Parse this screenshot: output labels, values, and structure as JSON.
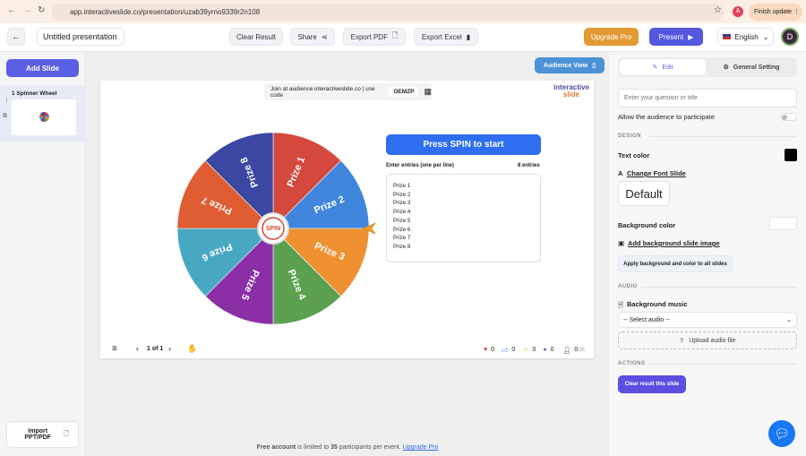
{
  "browser": {
    "url": "app.interactiveslide.co/presentation/uzab39yrno9339r2n108",
    "finish_update": "Finish update",
    "profile_initial": "A"
  },
  "header": {
    "title": "Untitled presentation",
    "clear_result": "Clear Result",
    "share": "Share",
    "export_pdf": "Export PDF",
    "export_excel": "Export Excel",
    "upgrade_pro": "Upgrade Pro",
    "present": "Present",
    "language": "English",
    "avatar": "D"
  },
  "sidebar": {
    "add_slide": "Add Slide",
    "slides": [
      {
        "label": "1 Spinner Wheel"
      }
    ],
    "import": "Import PPT/PDF"
  },
  "slide": {
    "audience_view": "Audience View",
    "join_text": "Join at audience.interactiveslide.co | use code",
    "code": "OEMZP",
    "logo_top": "interactive",
    "logo_bottom": "slide",
    "spin_button": "Press SPIN to start",
    "entries_label": "Enter entries (one per line)",
    "entries_count": "8 entries",
    "spin_center": "SPIN",
    "wheel": [
      {
        "label": "Prize 1",
        "color": "#d4483d"
      },
      {
        "label": "Prize 2",
        "color": "#3f86dc"
      },
      {
        "label": "Prize 3",
        "color": "#ef9130"
      },
      {
        "label": "Prize 4",
        "color": "#5ba14f"
      },
      {
        "label": "Prize 5",
        "color": "#8a2fa6"
      },
      {
        "label": "Prize 6",
        "color": "#48a8c2"
      },
      {
        "label": "Prize 7",
        "color": "#e05c32"
      },
      {
        "label": "Prize 8",
        "color": "#3b47a3"
      }
    ]
  },
  "footer": {
    "page": "1 of 1",
    "hearts": "0",
    "likes": "0",
    "smiles": "0",
    "wows": "0",
    "participants": "0",
    "participants_max": "/35"
  },
  "notice": {
    "bold1": "Free account",
    "mid": " is limited to ",
    "bold2": "35",
    "end": " participants per event. ",
    "link": "Upgrade Pro"
  },
  "panel": {
    "tab_edit": "Edit",
    "tab_general": "General Setting",
    "question_placeholder": "Enter your question or title",
    "allow_audience": "Allow the audience to participate",
    "design": "DESIGN",
    "text_color": "Text color",
    "text_color_value": "#000000",
    "change_font": "Change Font Slide",
    "font_value": "Default",
    "background_color": "Background color",
    "background_color_value": "#ffffff",
    "add_bg_image": "Add background slide image",
    "apply_all": "Apply background and color to all slides",
    "audio": "AUDIO",
    "background_music": "Background music",
    "select_audio": "-- Select audio --",
    "upload_audio": "Upload audio file",
    "actions": "ACTIONS",
    "clear_result_slide": "Clear result this slide"
  }
}
